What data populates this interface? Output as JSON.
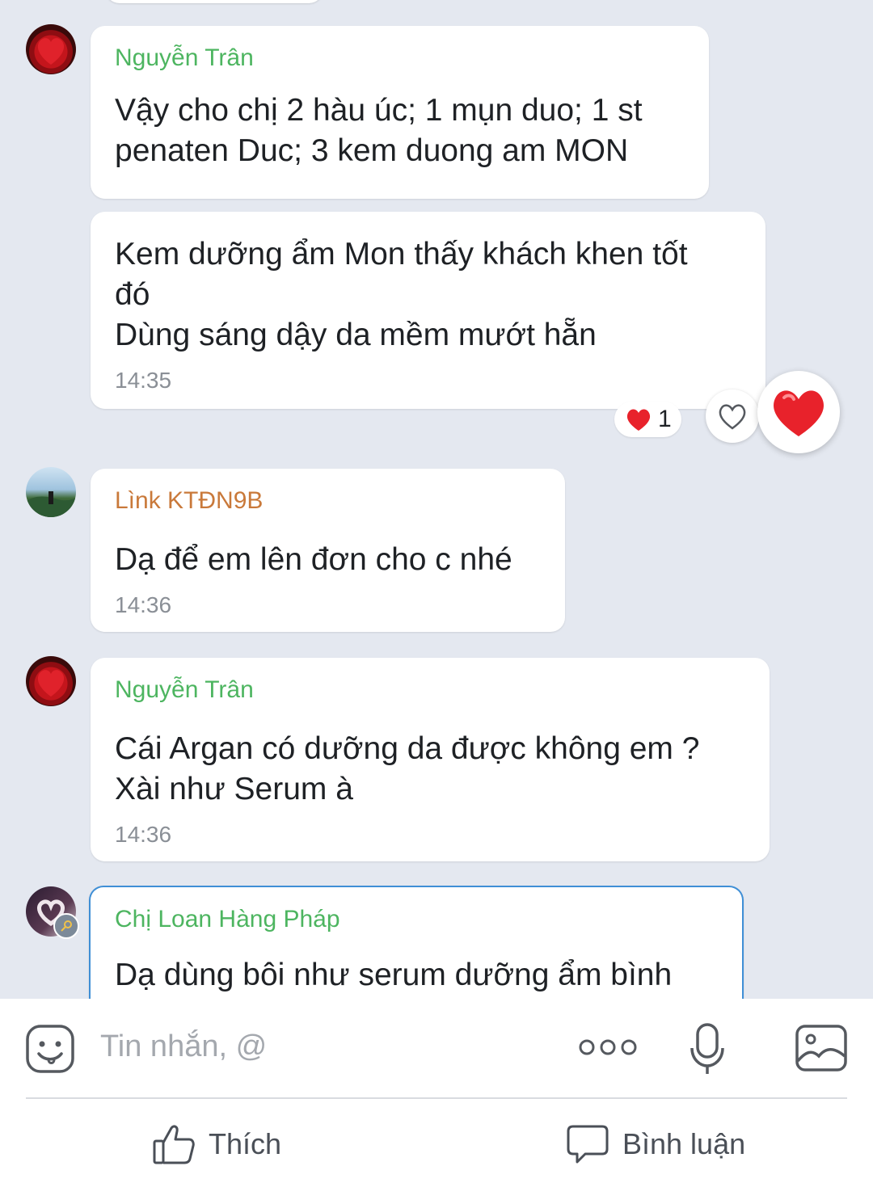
{
  "messages": [
    {
      "sender": "Nguyễn Trân",
      "text": "Vậy cho chị 2 hàu úc; 1 mụn duo; 1 st\npenaten Duc; 3 kem duong am MON"
    },
    {
      "text": "Kem dưỡng ẩm Mon thấy khách khen tốt\nđó\nDùng sáng dậy da mềm mướt hẵn",
      "time": "14:35",
      "reaction_count": "1"
    },
    {
      "sender": "Lìnk KTĐN9B",
      "text": "Dạ để em lên đơn cho c nhé",
      "time": "14:36"
    },
    {
      "sender": "Nguyễn Trân",
      "text": "Cái Argan có dưỡng da được không em ?\nXài như Serum à",
      "time": "14:36"
    },
    {
      "sender": "Chị Loan Hàng Pháp",
      "text": "Dạ dùng bôi như serum dưỡng ẩm bình"
    }
  ],
  "composer": {
    "placeholder": "Tin nhắn, @",
    "icons": [
      "emoji-icon",
      "more-icon",
      "microphone-icon",
      "image-icon"
    ]
  },
  "footer": {
    "like_label": "Thích",
    "comment_label": "Bình luận"
  },
  "colors": {
    "sender_green": "#4db560",
    "sender_orange": "#c9793a",
    "heart_red": "#e8222b",
    "outline_blue": "#3f8fd6"
  }
}
